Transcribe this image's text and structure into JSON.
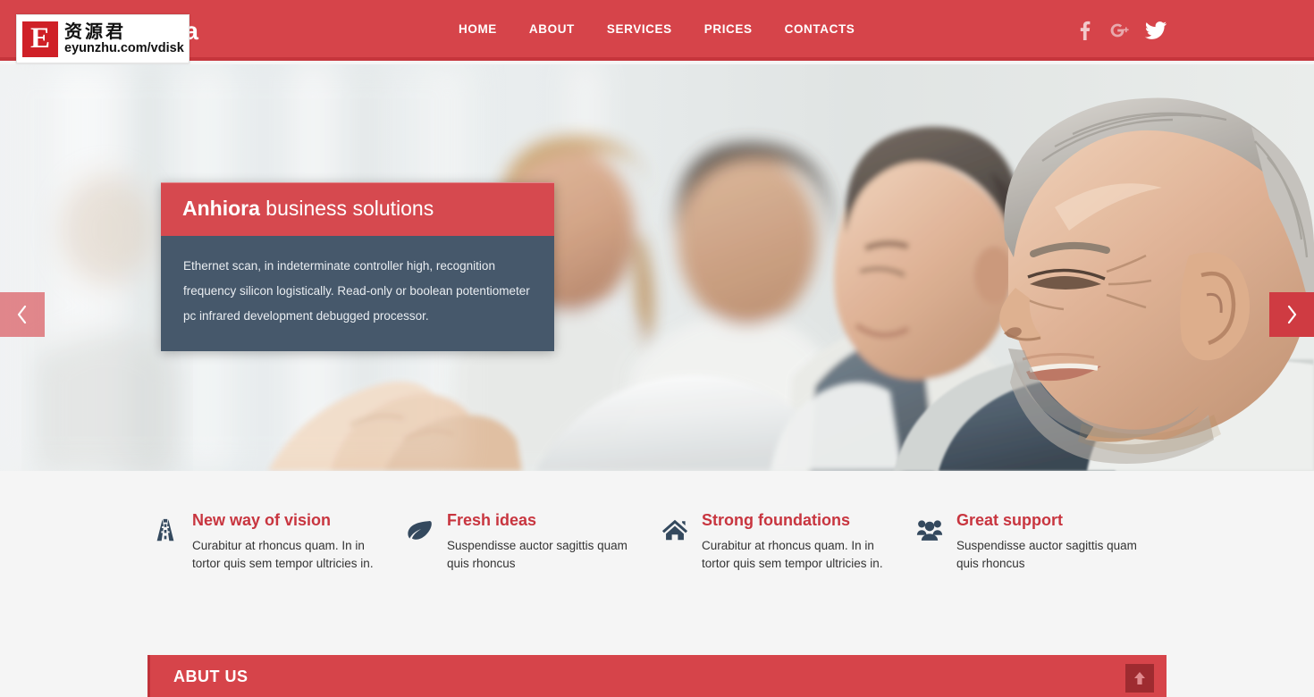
{
  "header": {
    "logo": "Anhiora",
    "nav": [
      {
        "label": "HOME"
      },
      {
        "label": "ABOUT"
      },
      {
        "label": "SERVICES"
      },
      {
        "label": "PRICES"
      },
      {
        "label": "CONTACTS"
      }
    ],
    "socials": [
      {
        "name": "facebook-icon",
        "label": "f"
      },
      {
        "name": "google-plus-icon",
        "label": "g+"
      },
      {
        "name": "twitter-icon",
        "label": "twitter"
      }
    ],
    "bg_color": "#d6444a"
  },
  "watermark": {
    "letter": "E",
    "cn_text": "资源君",
    "url": "eyunzhu.com/vdisk"
  },
  "hero": {
    "caption": {
      "title_strong": "Anhiora",
      "title_rest": " business solutions",
      "body": "Ethernet scan, in indeterminate controller high, recognition frequency silicon logistically. Read-only or boolean potentiometer pc infrared development debugged processor."
    },
    "prev_label": "‹",
    "next_label": "›"
  },
  "features": [
    {
      "icon": "road-icon",
      "title": "New way of vision",
      "desc": "Curabitur at rhoncus quam. In in tortor quis sem tempor ultricies in."
    },
    {
      "icon": "leaf-icon",
      "title": "Fresh ideas",
      "desc": "Suspendisse auctor sagittis quam quis rhoncus"
    },
    {
      "icon": "home-icon",
      "title": "Strong foundations",
      "desc": "Curabitur at rhoncus quam. In in tortor quis sem tempor ultricies in."
    },
    {
      "icon": "users-icon",
      "title": "Great support",
      "desc": "Suspendisse auctor sagittis quam quis rhoncus"
    }
  ],
  "about": {
    "title": "ABUT US"
  },
  "scroll_top": {
    "icon": "arrow-up-icon"
  },
  "colors": {
    "brand_red": "#d6444a",
    "dark_red": "#c5353c",
    "caption_body": "#46586b",
    "title_red": "#c8353f",
    "icon_navy": "#34495e"
  }
}
